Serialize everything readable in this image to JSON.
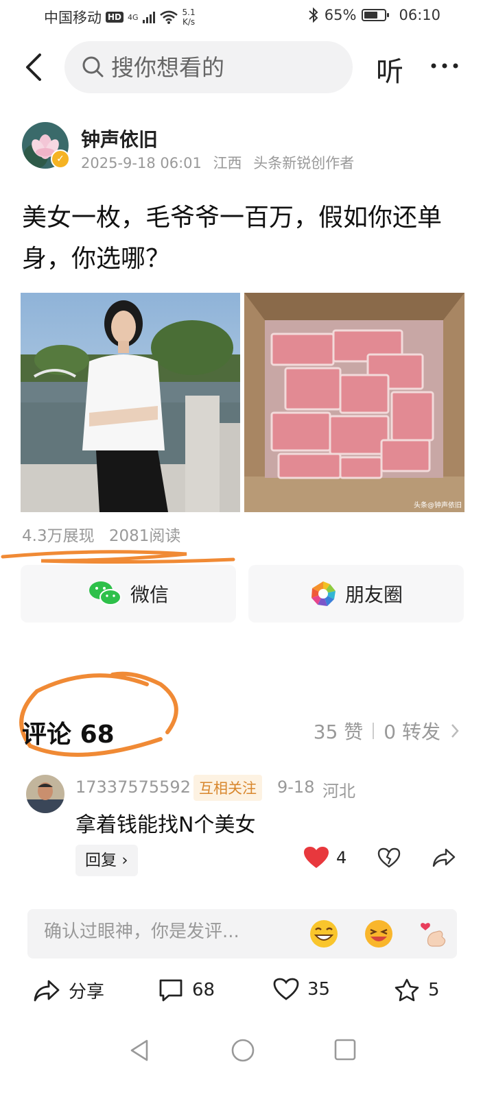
{
  "status_bar": {
    "carrier": "中国移动",
    "hd": "HD",
    "network": "4G",
    "speed_value": "5.1",
    "speed_unit": "K/s",
    "battery": "65%",
    "battery_level": 0.65,
    "time": "06:10"
  },
  "nav": {
    "search_placeholder": "搜你想看的",
    "listen_label": "听"
  },
  "author": {
    "name": "钟声依旧",
    "date": "2025-9-18 06:01",
    "location": "江西",
    "title": "头条新锐创作者"
  },
  "post": {
    "text": "美女一枚，毛爷爷一百万，假如你还单身，你选哪？",
    "watermark": "头条@钟声依旧",
    "impressions": "4.3万展现",
    "reads": "2081阅读"
  },
  "share": {
    "wechat": "微信",
    "moments": "朋友圈"
  },
  "comments_header": {
    "title": "评论",
    "count": "68",
    "likes": "35 赞",
    "reposts": "0 转发"
  },
  "comment": {
    "user": "17337575592",
    "tag": "互相关注",
    "date": "9-18",
    "region": "河北",
    "text": "拿着钱能找N个美女",
    "reply_label": "回复",
    "like_count": "4"
  },
  "input": {
    "placeholder": "确认过眼神，你是发评..."
  },
  "actions": {
    "share": "分享",
    "comments": "68",
    "likes": "35",
    "favorites": "5"
  },
  "colors": {
    "annotation": "#f08a35",
    "like_red": "#e8383d",
    "tag_bg": "#fdf2e2",
    "tag_text": "#d8862c"
  }
}
